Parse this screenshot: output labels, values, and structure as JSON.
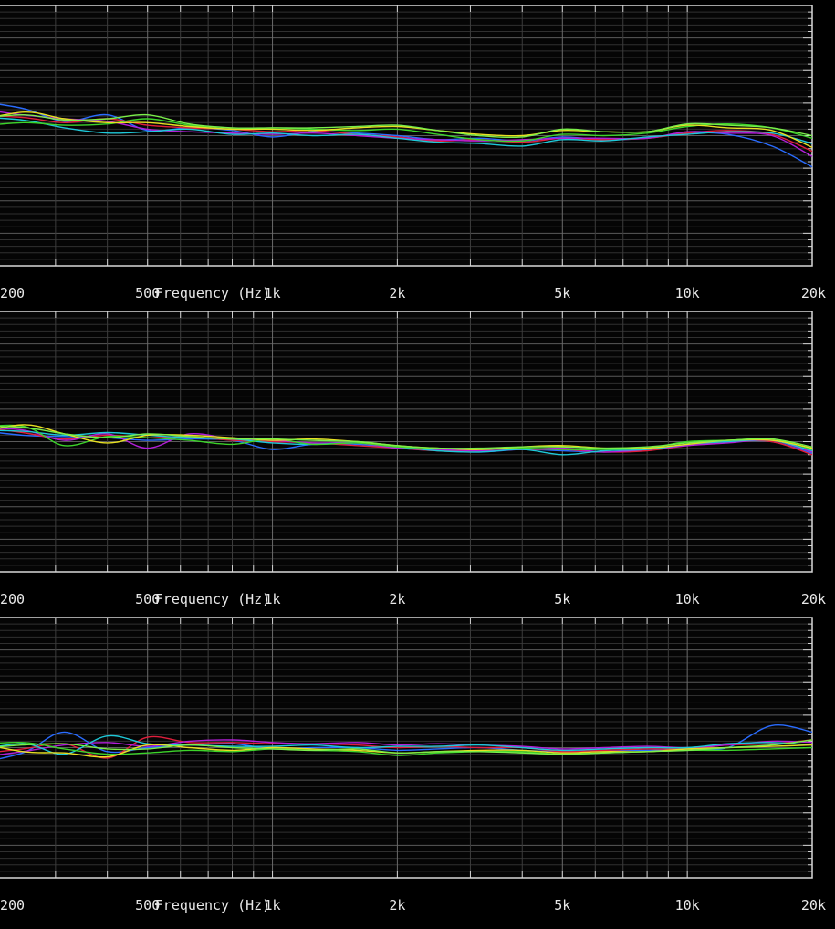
{
  "chart_data": [
    {
      "type": "line",
      "xlabel": "Frequency (Hz)",
      "xscale": "log",
      "xlim": [
        180,
        20000
      ],
      "ylim": [
        -10,
        10
      ],
      "grid": true,
      "xticks": [
        {
          "value": 200,
          "label": "200"
        },
        {
          "value": 500,
          "label": "500"
        },
        {
          "value": 1000,
          "label": "1k"
        },
        {
          "value": 2000,
          "label": "2k"
        },
        {
          "value": 5000,
          "label": "5k"
        },
        {
          "value": 10000,
          "label": "10k"
        },
        {
          "value": 20000,
          "label": "20k"
        }
      ],
      "x": [
        180,
        250,
        315,
        400,
        500,
        630,
        800,
        1000,
        1250,
        1600,
        2000,
        2500,
        3150,
        4000,
        5000,
        6300,
        8000,
        10000,
        12500,
        16000,
        20000
      ],
      "series": [
        {
          "color": "#2a6cff",
          "values": [
            2.8,
            2.1,
            1.1,
            1.6,
            0.4,
            0.6,
            0.4,
            -0.1,
            0.3,
            0.2,
            0.0,
            -0.3,
            -0.2,
            -0.4,
            -0.1,
            -0.3,
            -0.2,
            0.2,
            0.1,
            -0.8,
            -2.4
          ]
        },
        {
          "color": "#e01e3c",
          "values": [
            1.6,
            1.4,
            1.0,
            1.3,
            0.8,
            0.6,
            0.5,
            0.3,
            0.4,
            0.1,
            -0.1,
            -0.4,
            -0.3,
            -0.5,
            -0.2,
            -0.3,
            -0.2,
            0.2,
            0.4,
            0.1,
            -1.2
          ]
        },
        {
          "color": "#b21fd8",
          "values": [
            2.2,
            1.6,
            1.3,
            1.1,
            0.5,
            0.3,
            0.2,
            0.1,
            0.2,
            0.0,
            -0.2,
            -0.3,
            -0.4,
            -0.3,
            -0.2,
            -0.2,
            -0.2,
            0.3,
            0.2,
            0.0,
            -1.6
          ]
        },
        {
          "color": "#1ec8d8",
          "values": [
            1.5,
            1.2,
            0.6,
            0.2,
            0.3,
            0.5,
            0.1,
            0.2,
            0.0,
            0.1,
            -0.2,
            -0.5,
            -0.6,
            -0.8,
            -0.3,
            -0.4,
            -0.1,
            0.1,
            0.3,
            0.2,
            -0.6
          ]
        },
        {
          "color": "#3cd42a",
          "values": [
            0.6,
            1.0,
            0.8,
            0.9,
            1.3,
            0.8,
            0.5,
            0.6,
            0.5,
            0.4,
            0.5,
            0.1,
            -0.3,
            -0.4,
            0.1,
            0.0,
            0.2,
            0.7,
            0.9,
            0.6,
            -0.2
          ]
        },
        {
          "color": "#e8e022",
          "values": [
            0.9,
            1.8,
            1.3,
            1.0,
            1.0,
            0.7,
            0.5,
            0.5,
            0.4,
            0.6,
            0.7,
            0.4,
            0.1,
            0.0,
            0.4,
            0.3,
            0.3,
            0.8,
            0.6,
            0.4,
            -0.9
          ]
        },
        {
          "color": "#7aef4a",
          "values": [
            1.2,
            1.6,
            1.2,
            1.3,
            1.6,
            0.9,
            0.6,
            0.6,
            0.6,
            0.7,
            0.8,
            0.4,
            0.0,
            -0.1,
            0.5,
            0.3,
            0.3,
            0.9,
            0.8,
            0.6,
            0.0
          ]
        }
      ]
    },
    {
      "type": "line",
      "xlabel": "Frequency (Hz)",
      "xscale": "log",
      "xlim": [
        180,
        20000
      ],
      "ylim": [
        -10,
        10
      ],
      "grid": true,
      "xticks": [
        {
          "value": 200,
          "label": "200"
        },
        {
          "value": 500,
          "label": "500"
        },
        {
          "value": 1000,
          "label": "1k"
        },
        {
          "value": 2000,
          "label": "2k"
        },
        {
          "value": 5000,
          "label": "5k"
        },
        {
          "value": 10000,
          "label": "10k"
        },
        {
          "value": 20000,
          "label": "20k"
        }
      ],
      "x": [
        180,
        250,
        315,
        400,
        500,
        630,
        800,
        1000,
        1250,
        1600,
        2000,
        2500,
        3150,
        4000,
        5000,
        6300,
        8000,
        10000,
        12500,
        16000,
        20000
      ],
      "series": [
        {
          "color": "#2a6cff",
          "values": [
            1.0,
            0.5,
            0.4,
            0.3,
            0.1,
            0.2,
            0.1,
            -0.6,
            -0.2,
            -0.2,
            -0.5,
            -0.7,
            -0.8,
            -0.6,
            -0.7,
            -0.8,
            -0.6,
            -0.2,
            0.0,
            0.0,
            -0.9
          ]
        },
        {
          "color": "#e01e3c",
          "values": [
            1.3,
            0.7,
            0.2,
            0.5,
            0.3,
            0.4,
            0.1,
            0.0,
            -0.1,
            -0.3,
            -0.5,
            -0.7,
            -0.7,
            -0.6,
            -0.6,
            -0.8,
            -0.7,
            -0.3,
            0.0,
            0.0,
            -1.0
          ]
        },
        {
          "color": "#b21fd8",
          "values": [
            1.1,
            0.9,
            0.1,
            0.6,
            -0.5,
            0.6,
            0.2,
            0.1,
            -0.1,
            -0.1,
            -0.5,
            -0.6,
            -0.7,
            -0.6,
            -0.5,
            -0.8,
            -0.6,
            -0.3,
            -0.1,
            0.1,
            -0.8
          ]
        },
        {
          "color": "#1ec8d8",
          "values": [
            0.9,
            0.8,
            0.5,
            0.7,
            0.5,
            0.3,
            0.2,
            -0.1,
            -0.2,
            -0.1,
            -0.4,
            -0.7,
            -0.8,
            -0.6,
            -1.0,
            -0.7,
            -0.6,
            -0.2,
            0.0,
            0.1,
            -0.7
          ]
        },
        {
          "color": "#3cd42a",
          "values": [
            1.0,
            1.2,
            -0.3,
            0.4,
            0.3,
            0.1,
            -0.2,
            0.2,
            -0.2,
            -0.1,
            -0.4,
            -0.5,
            -0.6,
            -0.5,
            -0.6,
            -0.6,
            -0.5,
            0.0,
            0.1,
            0.2,
            -0.6
          ]
        },
        {
          "color": "#e8e022",
          "values": [
            0.4,
            1.3,
            0.6,
            -0.1,
            0.5,
            0.5,
            0.3,
            0.1,
            0.2,
            0.0,
            -0.3,
            -0.5,
            -0.6,
            -0.4,
            -0.3,
            -0.5,
            -0.5,
            -0.2,
            0.1,
            0.1,
            -0.5
          ]
        },
        {
          "color": "#7aef4a",
          "values": [
            1.2,
            1.1,
            0.6,
            0.3,
            0.6,
            0.4,
            0.2,
            0.2,
            0.1,
            0.0,
            -0.3,
            -0.5,
            -0.5,
            -0.4,
            -0.4,
            -0.5,
            -0.4,
            -0.1,
            0.1,
            0.2,
            -0.4
          ]
        }
      ]
    },
    {
      "type": "line",
      "xlabel": "Frequency (Hz)",
      "xscale": "log",
      "xlim": [
        180,
        20000
      ],
      "ylim": [
        -10,
        10
      ],
      "grid": true,
      "xticks": [
        {
          "value": 200,
          "label": "200"
        },
        {
          "value": 500,
          "label": "500"
        },
        {
          "value": 1000,
          "label": "1k"
        },
        {
          "value": 2000,
          "label": "2k"
        },
        {
          "value": 5000,
          "label": "5k"
        },
        {
          "value": 10000,
          "label": "10k"
        },
        {
          "value": 20000,
          "label": "20k"
        }
      ],
      "x": [
        180,
        250,
        315,
        400,
        500,
        630,
        800,
        1000,
        1250,
        1600,
        2000,
        2500,
        3150,
        4000,
        5000,
        6300,
        8000,
        10000,
        12500,
        16000,
        20000
      ],
      "series": [
        {
          "color": "#2a6cff",
          "values": [
            -1.4,
            -0.4,
            1.2,
            -0.3,
            0.0,
            0.2,
            0.3,
            -0.1,
            0.0,
            0.0,
            -0.2,
            -0.1,
            0.0,
            -0.2,
            -0.3,
            -0.2,
            -0.2,
            -0.1,
            0.0,
            1.7,
            1.2
          ]
        },
        {
          "color": "#e01e3c",
          "values": [
            -0.6,
            -0.1,
            0.3,
            -0.8,
            0.8,
            0.4,
            0.4,
            0.3,
            0.3,
            0.2,
            0.0,
            0.1,
            0.0,
            0.0,
            -0.3,
            -0.2,
            -0.1,
            -0.1,
            0.2,
            0.3,
            0.6
          ]
        },
        {
          "color": "#b21fd8",
          "values": [
            -0.9,
            -0.3,
            0.2,
            0.4,
            0.1,
            0.5,
            0.6,
            0.4,
            0.3,
            0.4,
            0.2,
            0.3,
            0.2,
            0.1,
            -0.1,
            0.0,
            0.1,
            0.0,
            0.2,
            0.5,
            0.4
          ]
        },
        {
          "color": "#1ec8d8",
          "values": [
            -0.4,
            0.3,
            -0.5,
            0.9,
            0.3,
            0.2,
            0.1,
            0.1,
            0.2,
            0.0,
            0.1,
            0.1,
            0.2,
            0.0,
            -0.2,
            -0.1,
            0.0,
            0.0,
            0.3,
            0.4,
            0.2
          ]
        },
        {
          "color": "#3cd42a",
          "values": [
            0.2,
            0.4,
            -0.1,
            -0.5,
            -0.4,
            -0.2,
            -0.3,
            -0.1,
            -0.2,
            -0.3,
            -0.6,
            -0.4,
            -0.3,
            -0.3,
            -0.5,
            -0.4,
            -0.3,
            -0.2,
            -0.2,
            -0.1,
            0.0
          ]
        },
        {
          "color": "#e8e022",
          "values": [
            0.6,
            -0.3,
            -0.4,
            -0.7,
            0.2,
            0.0,
            -0.2,
            0.0,
            -0.1,
            -0.2,
            -0.4,
            -0.3,
            -0.2,
            -0.2,
            -0.4,
            -0.3,
            -0.3,
            -0.1,
            0.0,
            0.1,
            0.2
          ]
        },
        {
          "color": "#7aef4a",
          "values": [
            -0.2,
            0.2,
            0.3,
            -0.1,
            -0.1,
            0.2,
            0.0,
            -0.1,
            -0.2,
            -0.1,
            -0.4,
            -0.3,
            -0.3,
            -0.4,
            -0.5,
            -0.4,
            -0.3,
            -0.2,
            0.0,
            0.2,
            0.6
          ]
        }
      ]
    }
  ]
}
